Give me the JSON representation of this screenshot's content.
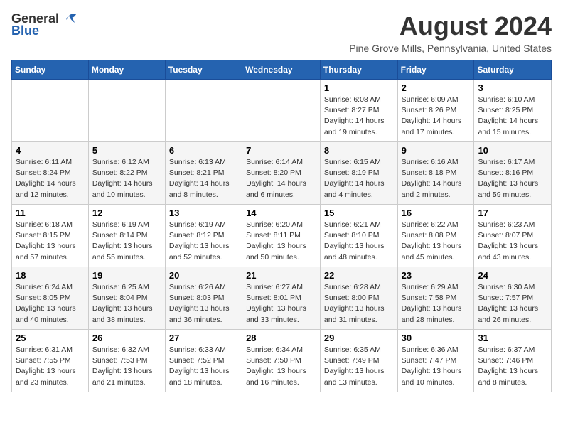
{
  "logo": {
    "general": "General",
    "blue": "Blue"
  },
  "title": "August 2024",
  "subtitle": "Pine Grove Mills, Pennsylvania, United States",
  "days_of_week": [
    "Sunday",
    "Monday",
    "Tuesday",
    "Wednesday",
    "Thursday",
    "Friday",
    "Saturday"
  ],
  "weeks": [
    [
      {
        "day": "",
        "info": ""
      },
      {
        "day": "",
        "info": ""
      },
      {
        "day": "",
        "info": ""
      },
      {
        "day": "",
        "info": ""
      },
      {
        "day": "1",
        "info": "Sunrise: 6:08 AM\nSunset: 8:27 PM\nDaylight: 14 hours and 19 minutes."
      },
      {
        "day": "2",
        "info": "Sunrise: 6:09 AM\nSunset: 8:26 PM\nDaylight: 14 hours and 17 minutes."
      },
      {
        "day": "3",
        "info": "Sunrise: 6:10 AM\nSunset: 8:25 PM\nDaylight: 14 hours and 15 minutes."
      }
    ],
    [
      {
        "day": "4",
        "info": "Sunrise: 6:11 AM\nSunset: 8:24 PM\nDaylight: 14 hours and 12 minutes."
      },
      {
        "day": "5",
        "info": "Sunrise: 6:12 AM\nSunset: 8:22 PM\nDaylight: 14 hours and 10 minutes."
      },
      {
        "day": "6",
        "info": "Sunrise: 6:13 AM\nSunset: 8:21 PM\nDaylight: 14 hours and 8 minutes."
      },
      {
        "day": "7",
        "info": "Sunrise: 6:14 AM\nSunset: 8:20 PM\nDaylight: 14 hours and 6 minutes."
      },
      {
        "day": "8",
        "info": "Sunrise: 6:15 AM\nSunset: 8:19 PM\nDaylight: 14 hours and 4 minutes."
      },
      {
        "day": "9",
        "info": "Sunrise: 6:16 AM\nSunset: 8:18 PM\nDaylight: 14 hours and 2 minutes."
      },
      {
        "day": "10",
        "info": "Sunrise: 6:17 AM\nSunset: 8:16 PM\nDaylight: 13 hours and 59 minutes."
      }
    ],
    [
      {
        "day": "11",
        "info": "Sunrise: 6:18 AM\nSunset: 8:15 PM\nDaylight: 13 hours and 57 minutes."
      },
      {
        "day": "12",
        "info": "Sunrise: 6:19 AM\nSunset: 8:14 PM\nDaylight: 13 hours and 55 minutes."
      },
      {
        "day": "13",
        "info": "Sunrise: 6:19 AM\nSunset: 8:12 PM\nDaylight: 13 hours and 52 minutes."
      },
      {
        "day": "14",
        "info": "Sunrise: 6:20 AM\nSunset: 8:11 PM\nDaylight: 13 hours and 50 minutes."
      },
      {
        "day": "15",
        "info": "Sunrise: 6:21 AM\nSunset: 8:10 PM\nDaylight: 13 hours and 48 minutes."
      },
      {
        "day": "16",
        "info": "Sunrise: 6:22 AM\nSunset: 8:08 PM\nDaylight: 13 hours and 45 minutes."
      },
      {
        "day": "17",
        "info": "Sunrise: 6:23 AM\nSunset: 8:07 PM\nDaylight: 13 hours and 43 minutes."
      }
    ],
    [
      {
        "day": "18",
        "info": "Sunrise: 6:24 AM\nSunset: 8:05 PM\nDaylight: 13 hours and 40 minutes."
      },
      {
        "day": "19",
        "info": "Sunrise: 6:25 AM\nSunset: 8:04 PM\nDaylight: 13 hours and 38 minutes."
      },
      {
        "day": "20",
        "info": "Sunrise: 6:26 AM\nSunset: 8:03 PM\nDaylight: 13 hours and 36 minutes."
      },
      {
        "day": "21",
        "info": "Sunrise: 6:27 AM\nSunset: 8:01 PM\nDaylight: 13 hours and 33 minutes."
      },
      {
        "day": "22",
        "info": "Sunrise: 6:28 AM\nSunset: 8:00 PM\nDaylight: 13 hours and 31 minutes."
      },
      {
        "day": "23",
        "info": "Sunrise: 6:29 AM\nSunset: 7:58 PM\nDaylight: 13 hours and 28 minutes."
      },
      {
        "day": "24",
        "info": "Sunrise: 6:30 AM\nSunset: 7:57 PM\nDaylight: 13 hours and 26 minutes."
      }
    ],
    [
      {
        "day": "25",
        "info": "Sunrise: 6:31 AM\nSunset: 7:55 PM\nDaylight: 13 hours and 23 minutes."
      },
      {
        "day": "26",
        "info": "Sunrise: 6:32 AM\nSunset: 7:53 PM\nDaylight: 13 hours and 21 minutes."
      },
      {
        "day": "27",
        "info": "Sunrise: 6:33 AM\nSunset: 7:52 PM\nDaylight: 13 hours and 18 minutes."
      },
      {
        "day": "28",
        "info": "Sunrise: 6:34 AM\nSunset: 7:50 PM\nDaylight: 13 hours and 16 minutes."
      },
      {
        "day": "29",
        "info": "Sunrise: 6:35 AM\nSunset: 7:49 PM\nDaylight: 13 hours and 13 minutes."
      },
      {
        "day": "30",
        "info": "Sunrise: 6:36 AM\nSunset: 7:47 PM\nDaylight: 13 hours and 10 minutes."
      },
      {
        "day": "31",
        "info": "Sunrise: 6:37 AM\nSunset: 7:46 PM\nDaylight: 13 hours and 8 minutes."
      }
    ]
  ]
}
